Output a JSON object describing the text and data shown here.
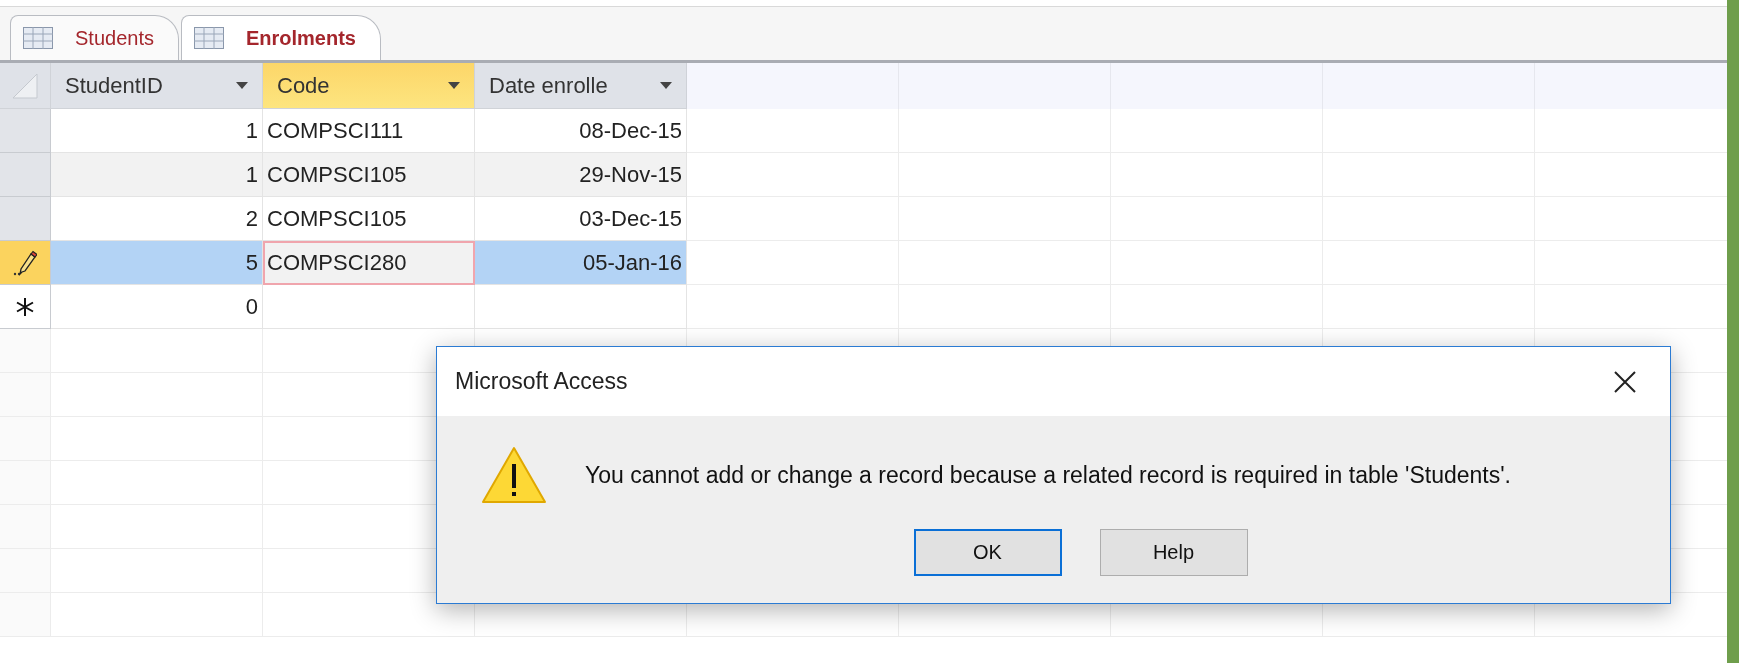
{
  "tabs": [
    {
      "label": "Students",
      "selected": false
    },
    {
      "label": "Enrolments",
      "selected": true
    }
  ],
  "columns": [
    {
      "label": "StudentID",
      "kind": "number",
      "selected": false
    },
    {
      "label": "Code",
      "kind": "text",
      "selected": true
    },
    {
      "label": "Date enrolle",
      "kind": "date",
      "selected": false
    }
  ],
  "rows": [
    {
      "kind": "record",
      "selected": false,
      "cells": [
        {
          "text": "1",
          "focused": false
        },
        {
          "text": "COMPSCI111",
          "focused": false
        },
        {
          "text": "08-Dec-15",
          "focused": false
        }
      ]
    },
    {
      "kind": "record",
      "selected": false,
      "cells": [
        {
          "text": "1",
          "focused": false
        },
        {
          "text": "COMPSCI105",
          "focused": false
        },
        {
          "text": "29-Nov-15",
          "focused": false
        }
      ]
    },
    {
      "kind": "record",
      "selected": false,
      "cells": [
        {
          "text": "2",
          "focused": false
        },
        {
          "text": "COMPSCI105",
          "focused": false
        },
        {
          "text": "03-Dec-15",
          "focused": false
        }
      ]
    },
    {
      "kind": "editing",
      "selected": true,
      "cells": [
        {
          "text": "5",
          "focused": false
        },
        {
          "text": "COMPSCI280",
          "focused": true
        },
        {
          "text": "05-Jan-16",
          "focused": false
        }
      ]
    },
    {
      "kind": "new",
      "selected": false,
      "cells": [
        {
          "text": "0",
          "focused": false
        }
      ]
    }
  ],
  "dialog": {
    "title": "Microsoft Access",
    "message": "You cannot add or change a record because a related record is required in table 'Students'.",
    "buttons": [
      {
        "label": "OK",
        "default": true
      },
      {
        "label": "Help",
        "default": false
      }
    ]
  }
}
